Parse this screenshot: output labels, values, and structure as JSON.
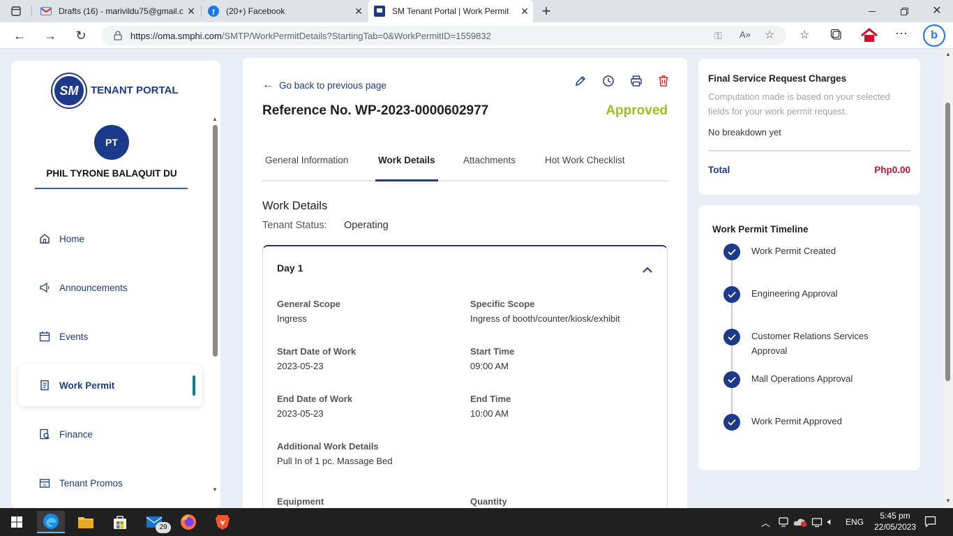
{
  "browser": {
    "tabs": [
      {
        "title": "Drafts (16) - marivildu75@gmail.c",
        "icon": "gmail-icon"
      },
      {
        "title": "(20+) Facebook",
        "icon": "facebook-icon"
      },
      {
        "title": "SM Tenant Portal | Work Permit",
        "icon": "sm-portal-icon"
      }
    ],
    "url_host": "https://oma.smphi.com",
    "url_path": "/SMTP/WorkPermitDetails?StartingTab=0&WorkPermitID=1559832"
  },
  "sidebar": {
    "brand_logo": "SM",
    "brand_title": "TENANT PORTAL",
    "avatar_initials": "PT",
    "user_name": "PHIL TYRONE BALAQUIT DU",
    "items": [
      {
        "label": "Home",
        "icon": "home-icon"
      },
      {
        "label": "Announcements",
        "icon": "megaphone-icon"
      },
      {
        "label": "Events",
        "icon": "calendar-icon"
      },
      {
        "label": "Work Permit",
        "icon": "document-icon"
      },
      {
        "label": "Finance",
        "icon": "finance-icon"
      },
      {
        "label": "Tenant Promos",
        "icon": "promo-icon"
      }
    ]
  },
  "main": {
    "back_link": "Go back to previous page",
    "reference": "Reference No. WP-2023-0000602977",
    "status": "Approved",
    "tabs": [
      "General Information",
      "Work Details",
      "Attachments",
      "Hot Work Checklist"
    ],
    "active_tab": "Work Details",
    "section_title": "Work Details",
    "tenant_status_label": "Tenant Status:",
    "tenant_status_value": "Operating",
    "day_label": "Day 1",
    "fields": {
      "general_scope_label": "General Scope",
      "general_scope_value": "Ingress",
      "specific_scope_label": "Specific Scope",
      "specific_scope_value": "Ingress of booth/counter/kiosk/exhibit",
      "start_date_label": "Start Date of Work",
      "start_date_value": "2023-05-23",
      "start_time_label": "Start Time",
      "start_time_value": "09:00 AM",
      "end_date_label": "End Date of Work",
      "end_date_value": "2023-05-23",
      "end_time_label": "End Time",
      "end_time_value": "10:00 AM",
      "additional_label": "Additional Work Details",
      "additional_value": "Pull In of 1 pc. Massage Bed",
      "equipment_label": "Equipment",
      "quantity_label": "Quantity"
    }
  },
  "charges": {
    "title": "Final Service Request Charges",
    "note": "Computation made is based on your selected fields for your work permit request.",
    "breakdown": "No breakdown yet",
    "total_label": "Total",
    "total_value": "Php0.00"
  },
  "timeline": {
    "title": "Work Permit Timeline",
    "steps": [
      "Work Permit Created",
      "Engineering Approval",
      "Customer Relations Services Approval",
      "Mall Operations Approval",
      "Work Permit Approved"
    ]
  },
  "taskbar": {
    "mail_badge": "29",
    "language": "ENG",
    "time": "5:45 pm",
    "date": "22/05/2023"
  },
  "colors": {
    "brand_navy": "#1d3a8a",
    "approved_green": "#9dbf1f",
    "total_red": "#c0152b",
    "active_indicator": "#0f7d8c"
  }
}
